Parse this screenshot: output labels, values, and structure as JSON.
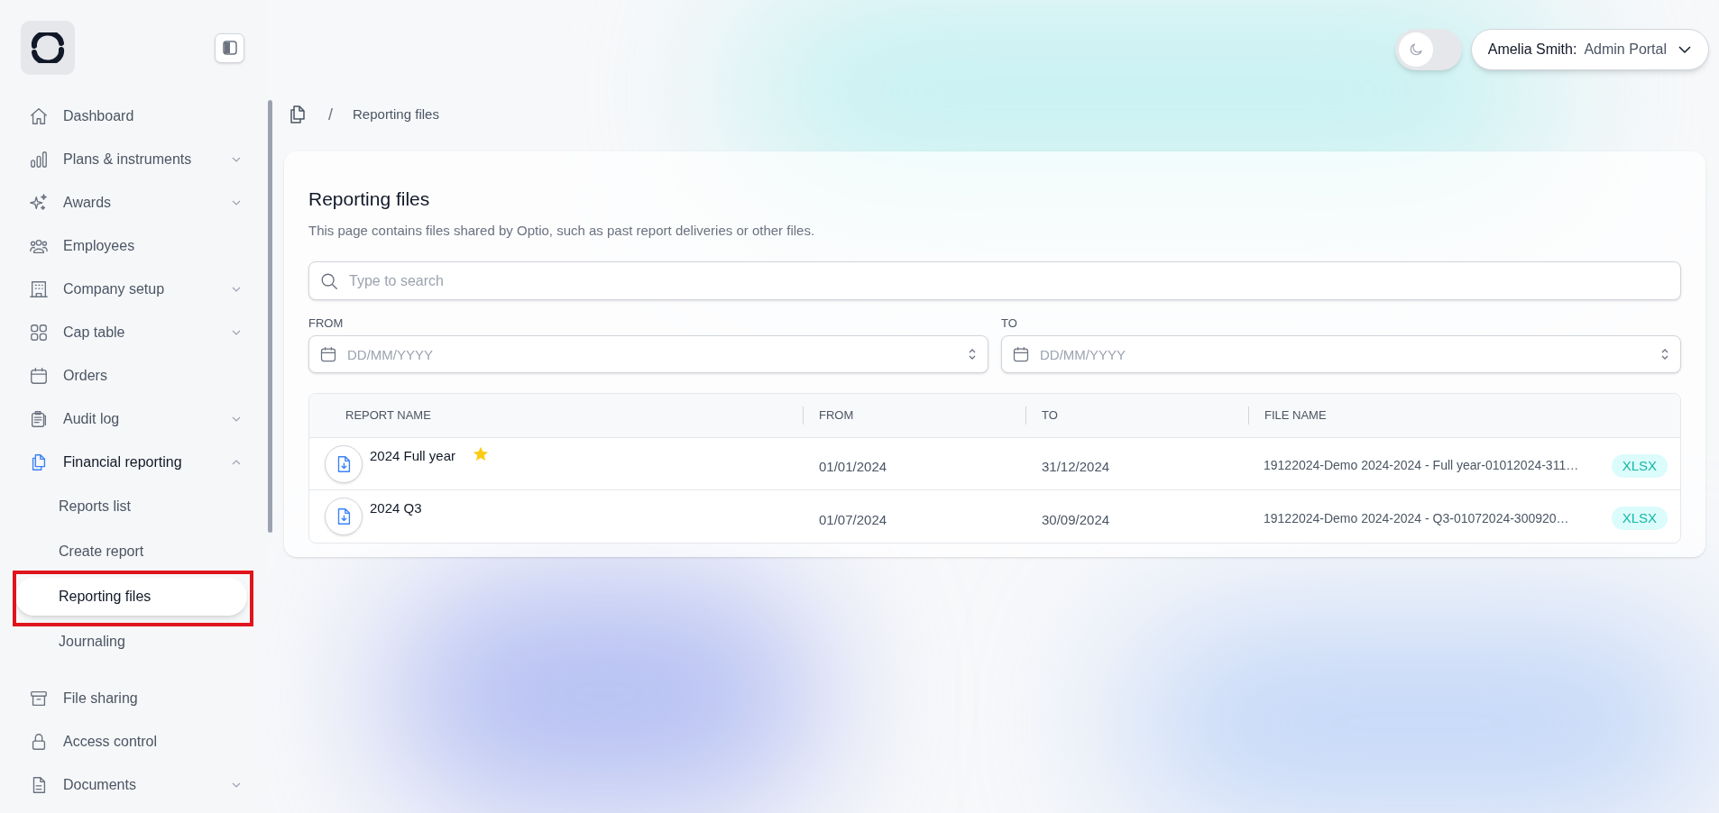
{
  "sidebar": {
    "items": [
      {
        "label": "Dashboard",
        "selected": false
      },
      {
        "label": "Plans & instruments",
        "selected": false,
        "expanded": false
      },
      {
        "label": "Awards",
        "selected": false,
        "expanded": false
      },
      {
        "label": "Employees",
        "selected": false
      },
      {
        "label": "Company setup",
        "selected": false,
        "expanded": false
      },
      {
        "label": "Cap table",
        "selected": false,
        "expanded": false
      },
      {
        "label": "Orders",
        "selected": false
      },
      {
        "label": "Audit log",
        "selected": false,
        "expanded": false
      },
      {
        "label": "Financial reporting",
        "selected": true,
        "expanded": true,
        "children": [
          {
            "label": "Reports list",
            "selected": false
          },
          {
            "label": "Create report",
            "selected": false
          },
          {
            "label": "Reporting files",
            "selected": true
          },
          {
            "label": "Journaling",
            "selected": false
          }
        ]
      },
      {
        "label": "File sharing",
        "selected": false
      },
      {
        "label": "Access control",
        "selected": false
      },
      {
        "label": "Documents",
        "selected": false,
        "expanded": false
      }
    ]
  },
  "header": {
    "theme_toggle": {
      "on": false
    },
    "user_menu": {
      "name": "Amelia Smith:",
      "portal": "Admin Portal"
    }
  },
  "breadcrumb": {
    "separator": "/",
    "current": "Reporting files"
  },
  "page": {
    "title": "Reporting files",
    "description": "This page contains files shared by Optio, such as past report deliveries or other files.",
    "search": {
      "placeholder": "Type to search"
    },
    "from": {
      "label": "FROM",
      "placeholder": "DD/MM/YYYY"
    },
    "to": {
      "label": "TO",
      "placeholder": "DD/MM/YYYY"
    }
  },
  "table": {
    "columns": [
      "REPORT NAME",
      "FROM",
      "TO",
      "FILE NAME"
    ],
    "rows": [
      {
        "name": "2024 Full year",
        "starred": true,
        "from": "01/01/2024",
        "to": "31/12/2024",
        "file_name": "19122024-Demo 2024-2024 - Full year-01012024-311…",
        "file_type": "XLSX"
      },
      {
        "name": "2024 Q3",
        "starred": false,
        "from": "01/07/2024",
        "to": "30/09/2024",
        "file_name": "19122024-Demo 2024-2024 - Q3-01072024-300920…",
        "file_type": "XLSX"
      }
    ]
  }
}
